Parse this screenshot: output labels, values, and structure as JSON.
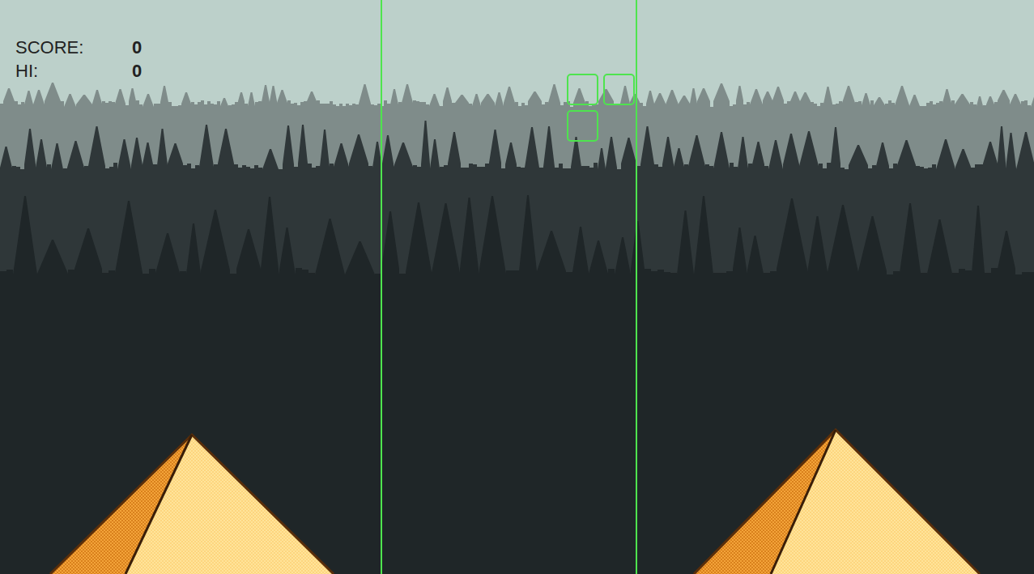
{
  "hud": {
    "score_label": "SCORE:",
    "score": "0",
    "hi_label": "HI:",
    "hi": "0"
  },
  "piece": {
    "cells": [
      {
        "col": 5,
        "row": 2
      },
      {
        "col": 6,
        "row": 2
      },
      {
        "col": 5,
        "row": 3
      }
    ]
  }
}
